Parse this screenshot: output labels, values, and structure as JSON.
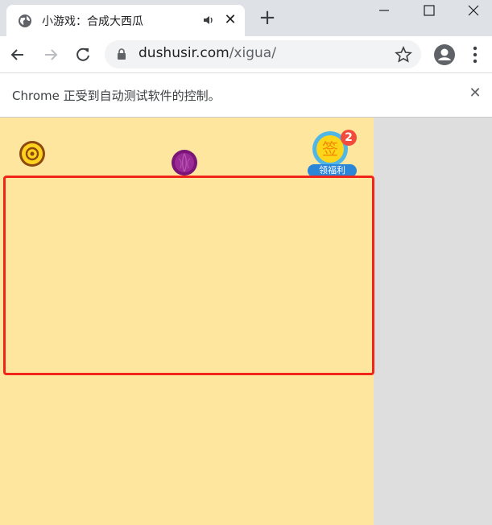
{
  "browser": {
    "tab": {
      "title": "小游戏：合成大西瓜",
      "favicon": "globe-icon",
      "audio_icon": "speaker-icon",
      "close_label": "✕"
    },
    "new_tab_label": "+",
    "window_controls": [
      "minimize-icon",
      "maximize-icon",
      "close-icon"
    ],
    "toolbar": {
      "url_host": "dushusir.com",
      "url_path": "/xigua/"
    },
    "infobar": {
      "message": "Chrome 正受到自动测试软件的控制。",
      "close_label": "✕"
    }
  },
  "game": {
    "background_color": "#ffe69f",
    "sign_in": {
      "icon_char": "签",
      "badge_count": "2",
      "label": "领福利"
    },
    "highlight_color": "#f2251a"
  }
}
